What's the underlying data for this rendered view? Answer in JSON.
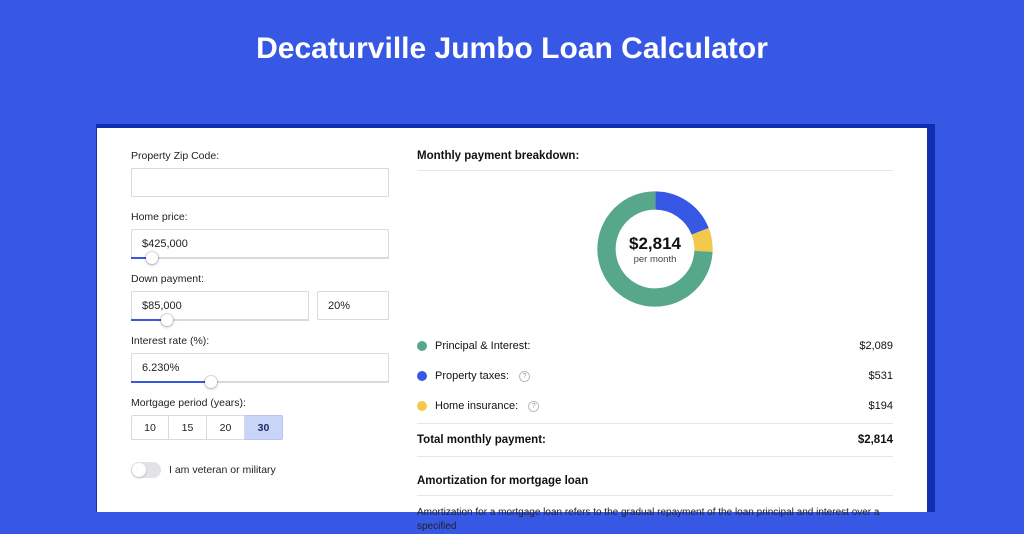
{
  "header": {
    "title": "Decaturville Jumbo Loan Calculator"
  },
  "form": {
    "zip": {
      "label": "Property Zip Code:",
      "value": ""
    },
    "price": {
      "label": "Home price:",
      "value": "$425,000",
      "slider_pct": 8
    },
    "down": {
      "label": "Down payment:",
      "amount": "$85,000",
      "percent": "20%",
      "slider_pct": 20
    },
    "rate": {
      "label": "Interest rate (%):",
      "value": "6.230%",
      "slider_pct": 31
    },
    "period": {
      "label": "Mortgage period (years):",
      "options": [
        "10",
        "15",
        "20",
        "30"
      ],
      "selected": "30"
    },
    "veteran": {
      "label": "I am veteran or military",
      "on": false
    }
  },
  "breakdown": {
    "title": "Monthly payment breakdown:",
    "center_amount": "$2,814",
    "center_sub": "per month",
    "items": [
      {
        "color": "c-green",
        "label": "Principal & Interest:",
        "value": "$2,089",
        "pct": 74.2,
        "help": false
      },
      {
        "color": "c-blue",
        "label": "Property taxes:",
        "value": "$531",
        "pct": 18.9,
        "help": true
      },
      {
        "color": "c-yellow",
        "label": "Home insurance:",
        "value": "$194",
        "pct": 6.9,
        "help": true
      }
    ],
    "total_label": "Total monthly payment:",
    "total_value": "$2,814"
  },
  "amortization": {
    "title": "Amortization for mortgage loan",
    "text": "Amortization for a mortgage loan refers to the gradual repayment of the loan principal and interest over a specified"
  },
  "chart_data": {
    "type": "pie",
    "title": "Monthly payment breakdown",
    "categories": [
      "Principal & Interest",
      "Property taxes",
      "Home insurance"
    ],
    "values": [
      2089,
      531,
      194
    ],
    "colors": [
      "#57a88a",
      "#3757e5",
      "#f2c94c"
    ],
    "total": 2814,
    "center_label": "$2,814 per month"
  }
}
